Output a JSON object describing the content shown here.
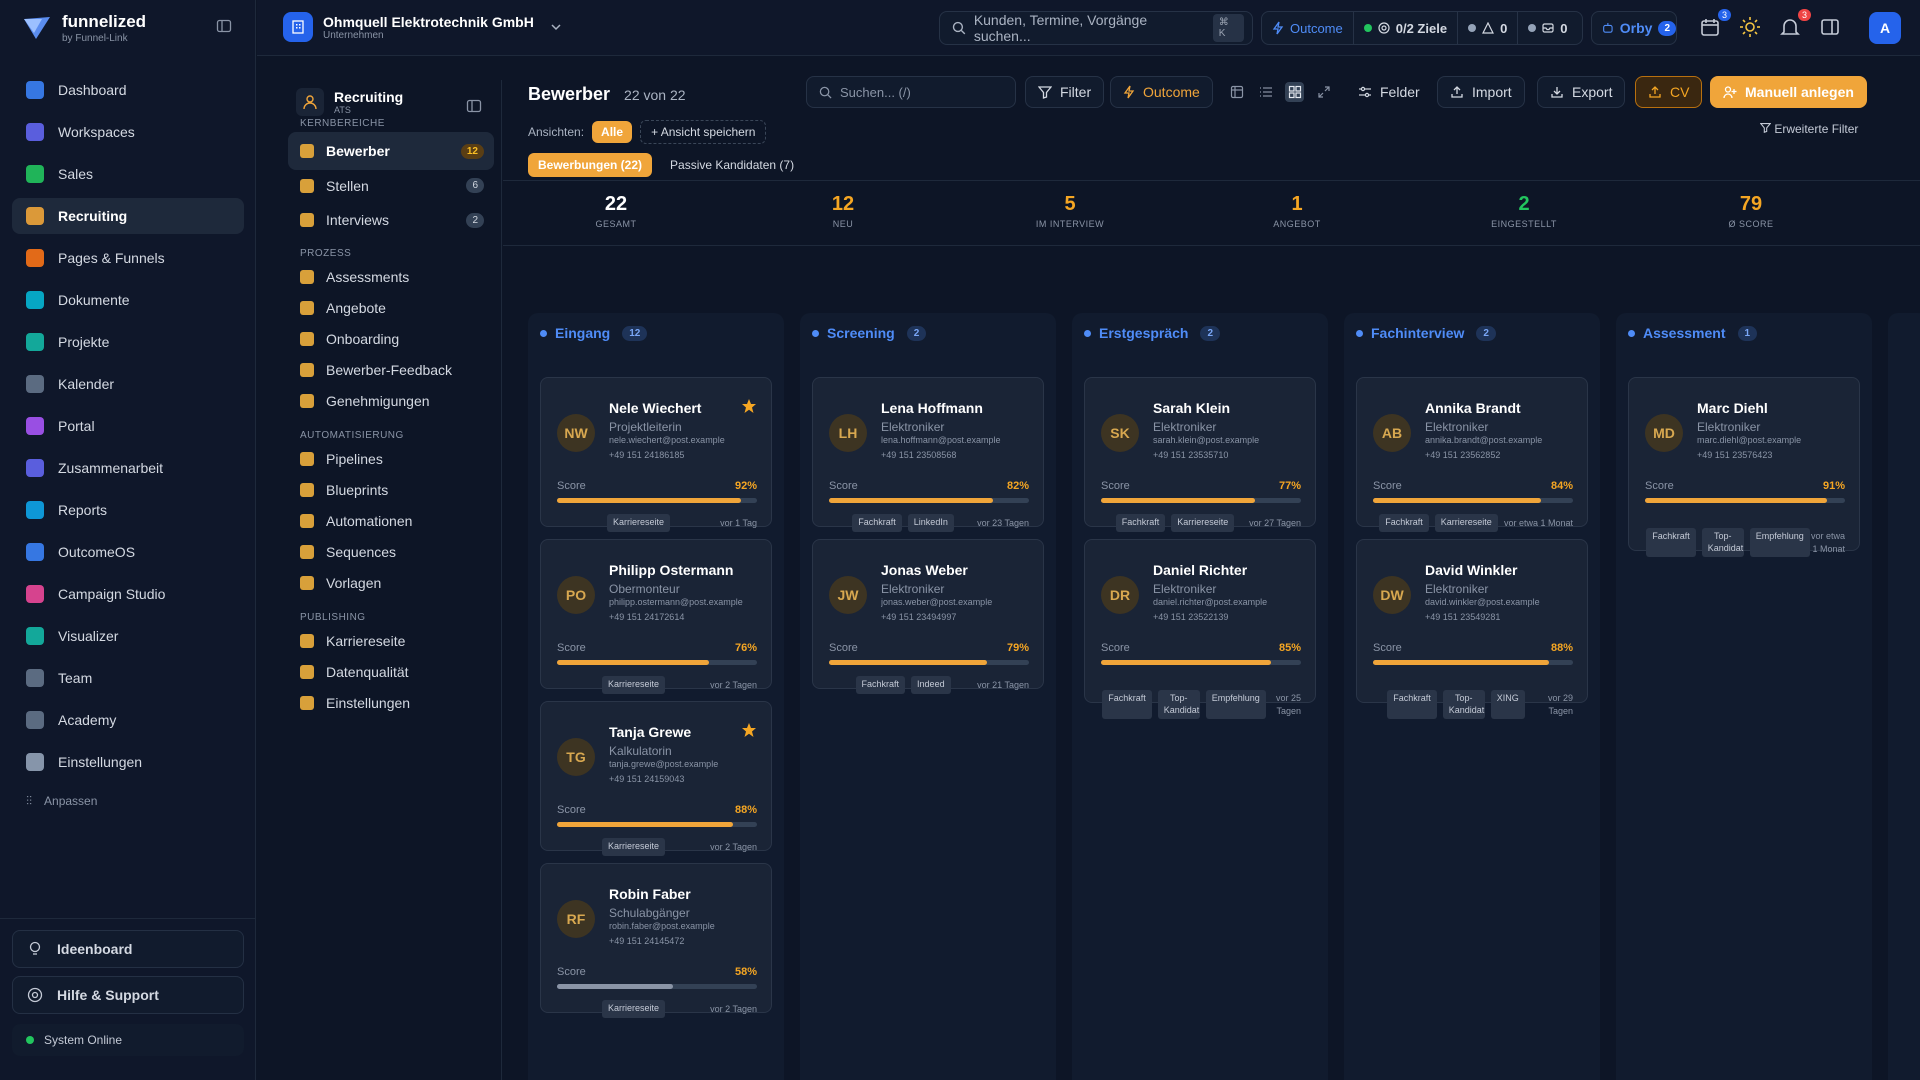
{
  "brand": {
    "name": "funnelized",
    "sub": "by Funnel-Link"
  },
  "sidebar": {
    "items": [
      {
        "label": "Dashboard",
        "icon": "dashboard-icon",
        "color": "#3b82f6"
      },
      {
        "label": "Workspaces",
        "icon": "workspaces-icon",
        "color": "#6366f1"
      },
      {
        "label": "Sales",
        "icon": "sales-icon",
        "color": "#22c55e"
      },
      {
        "label": "Recruiting",
        "icon": "recruiting-icon",
        "color": "#f0a53a",
        "active": true
      },
      {
        "label": "Pages & Funnels",
        "icon": "funnel-icon",
        "color": "#f97316"
      },
      {
        "label": "Dokumente",
        "icon": "document-icon",
        "color": "#06b6d4"
      },
      {
        "label": "Projekte",
        "icon": "project-icon",
        "color": "#14b8a6"
      },
      {
        "label": "Kalender",
        "icon": "calendar-icon",
        "color": "#64748b"
      },
      {
        "label": "Portal",
        "icon": "portal-icon",
        "color": "#a855f7"
      },
      {
        "label": "Zusammenarbeit",
        "icon": "collaboration-icon",
        "color": "#6366f1"
      },
      {
        "label": "Reports",
        "icon": "reports-icon",
        "color": "#0ea5e9"
      },
      {
        "label": "OutcomeOS",
        "icon": "outcome-icon",
        "color": "#3b82f6"
      },
      {
        "label": "Campaign Studio",
        "icon": "flag-icon",
        "color": "#ec4899"
      },
      {
        "label": "Visualizer",
        "icon": "visualizer-icon",
        "color": "#14b8a6"
      },
      {
        "label": "Team",
        "icon": "team-icon",
        "color": "#64748b"
      },
      {
        "label": "Academy",
        "icon": "academy-icon",
        "color": "#64748b"
      },
      {
        "label": "Einstellungen",
        "icon": "settings-icon",
        "color": "#94a3b8"
      }
    ],
    "customize": "Anpassen",
    "ideaboard": "Ideenboard",
    "help": "Hilfe & Support",
    "system": "System Online"
  },
  "topbar": {
    "company": "Ohmquell Elektrotechnik GmbH",
    "company_sub": "Unternehmen",
    "search_placeholder": "Kunden, Termine, Vorgänge suchen...",
    "search_kbd": "⌘ K",
    "outcome": "Outcome",
    "goals": "0/2 Ziele",
    "alerts": "0",
    "messages": "0",
    "orby": "Orby",
    "orby_count": "2",
    "calendar_badge": "3",
    "notif_badge": "3",
    "avatar": "A"
  },
  "subnav": {
    "title": "Recruiting",
    "subtitle": "ATS",
    "sections": {
      "core": "KERNBEREICHE",
      "process": "PROZESS",
      "automation": "AUTOMATISIERUNG",
      "publishing": "PUBLISHING"
    },
    "core": [
      {
        "label": "Bewerber",
        "count": "12"
      },
      {
        "label": "Stellen",
        "count": "6"
      },
      {
        "label": "Interviews",
        "count": "2"
      }
    ],
    "process": [
      "Assessments",
      "Angebote",
      "Onboarding",
      "Bewerber-Feedback",
      "Genehmigungen"
    ],
    "automation": [
      "Pipelines",
      "Blueprints",
      "Automationen",
      "Sequences",
      "Vorlagen"
    ],
    "publishing": [
      "Karriereseite",
      "Datenqualität",
      "Einstellungen"
    ]
  },
  "main": {
    "title": "Bewerber",
    "count": "22 von 22",
    "search_placeholder": "Suchen... (/)",
    "filter": "Filter",
    "outcome": "Outcome",
    "fields": "Felder",
    "import": "Import",
    "export": "Export",
    "cv": "CV",
    "create": "Manuell anlegen",
    "views_label": "Ansichten:",
    "views_all": "Alle",
    "save_view": "Ansicht speichern",
    "advanced_filter": "Erweiterte Filter",
    "tabs": [
      "Bewerbungen (22)",
      "Passive Kandidaten (7)"
    ]
  },
  "kpis": [
    {
      "value": "22",
      "label": "GESAMT"
    },
    {
      "value": "12",
      "label": "NEU"
    },
    {
      "value": "5",
      "label": "IM INTERVIEW"
    },
    {
      "value": "1",
      "label": "ANGEBOT"
    },
    {
      "value": "2",
      "label": "EINGESTELLT"
    },
    {
      "value": "79",
      "label": "Ø SCORE"
    }
  ],
  "score_label": "Score",
  "columns": [
    {
      "title": "Eingang",
      "count": "12",
      "cards": [
        {
          "initials": "NW",
          "name": "Nele Wiechert",
          "role": "Projektleiterin",
          "email": "nele.wiechert@post.example",
          "phone": "+49 151 24186185",
          "score": 92,
          "score_text": "92%",
          "tags": [
            "Karriereseite"
          ],
          "time": "vor 1 Tag",
          "star": true
        },
        {
          "initials": "PO",
          "name": "Philipp Ostermann",
          "role": "Obermonteur",
          "email": "philipp.ostermann@post.example",
          "phone": "+49 151 24172614",
          "score": 76,
          "score_text": "76%",
          "tags": [
            "Karriereseite"
          ],
          "time": "vor 2 Tagen",
          "star": false
        },
        {
          "initials": "TG",
          "name": "Tanja Grewe",
          "role": "Kalkulatorin",
          "email": "tanja.grewe@post.example",
          "phone": "+49 151 24159043",
          "score": 88,
          "score_text": "88%",
          "tags": [
            "Karriereseite"
          ],
          "time": "vor 2 Tagen",
          "star": true
        },
        {
          "initials": "RF",
          "name": "Robin Faber",
          "role": "Schulabgänger",
          "email": "robin.faber@post.example",
          "phone": "+49 151 24145472",
          "score": 58,
          "score_text": "58%",
          "tags": [
            "Karriereseite"
          ],
          "time": "vor 2 Tagen",
          "star": false
        }
      ]
    },
    {
      "title": "Screening",
      "count": "2",
      "cards": [
        {
          "initials": "LH",
          "name": "Lena Hoffmann",
          "role": "Elektroniker",
          "email": "lena.hoffmann@post.example",
          "phone": "+49 151 23508568",
          "score": 82,
          "score_text": "82%",
          "tags": [
            "Fachkraft",
            "LinkedIn"
          ],
          "time": "vor 23 Tagen",
          "star": false
        },
        {
          "initials": "JW",
          "name": "Jonas Weber",
          "role": "Elektroniker",
          "email": "jonas.weber@post.example",
          "phone": "+49 151 23494997",
          "score": 79,
          "score_text": "79%",
          "tags": [
            "Fachkraft",
            "Indeed"
          ],
          "time": "vor 21 Tagen",
          "star": false
        }
      ]
    },
    {
      "title": "Erstgespräch",
      "count": "2",
      "cards": [
        {
          "initials": "SK",
          "name": "Sarah Klein",
          "role": "Elektroniker",
          "email": "sarah.klein@post.example",
          "phone": "+49 151 23535710",
          "score": 77,
          "score_text": "77%",
          "tags": [
            "Fachkraft",
            "Karriereseite"
          ],
          "time": "vor 27 Tagen",
          "star": false
        },
        {
          "initials": "DR",
          "name": "Daniel Richter",
          "role": "Elektroniker",
          "email": "daniel.richter@post.example",
          "phone": "+49 151 23522139",
          "score": 85,
          "score_text": "85%",
          "tags": [
            "Fachkraft",
            "Top-Kandidat",
            "Empfehlung"
          ],
          "time": "vor 25 Tagen",
          "star": false
        }
      ]
    },
    {
      "title": "Fachinterview",
      "count": "2",
      "cards": [
        {
          "initials": "AB",
          "name": "Annika Brandt",
          "role": "Elektroniker",
          "email": "annika.brandt@post.example",
          "phone": "+49 151 23562852",
          "score": 84,
          "score_text": "84%",
          "tags": [
            "Fachkraft",
            "Karriereseite"
          ],
          "time": "vor etwa 1 Monat",
          "star": false
        },
        {
          "initials": "DW",
          "name": "David Winkler",
          "role": "Elektroniker",
          "email": "david.winkler@post.example",
          "phone": "+49 151 23549281",
          "score": 88,
          "score_text": "88%",
          "tags": [
            "Fachkraft",
            "Top-Kandidat",
            "XING"
          ],
          "time": "vor 29 Tagen",
          "star": false
        }
      ]
    },
    {
      "title": "Assessment",
      "count": "1",
      "cards": [
        {
          "initials": "MD",
          "name": "Marc Diehl",
          "role": "Elektroniker",
          "email": "marc.diehl@post.example",
          "phone": "+49 151 23576423",
          "score": 91,
          "score_text": "91%",
          "tags": [
            "Fachkraft",
            "Top-Kandidat",
            "Empfehlung"
          ],
          "time": "vor etwa 1 Monat",
          "star": false
        }
      ]
    }
  ]
}
